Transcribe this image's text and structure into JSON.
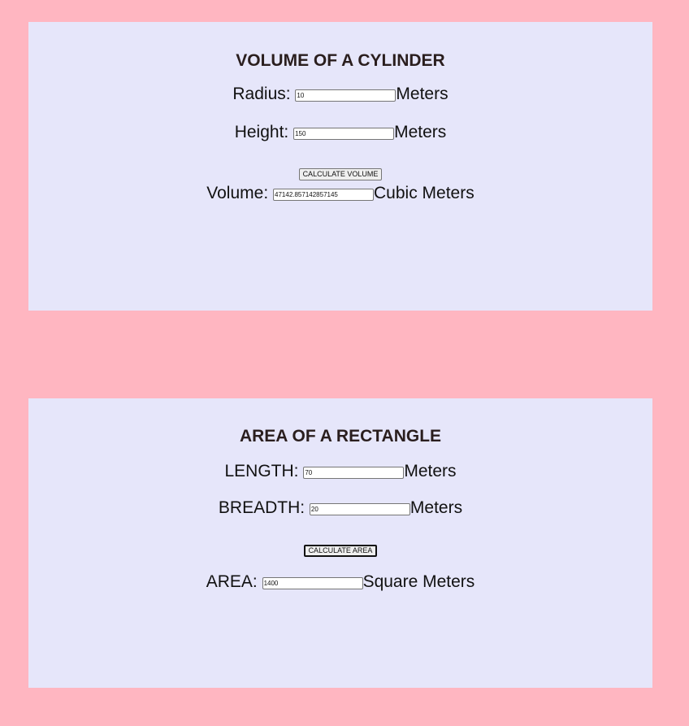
{
  "cylinder": {
    "title": "VOLUME OF A CYLINDER",
    "radius_label": "Radius:",
    "radius_value": "10",
    "radius_unit": "Meters",
    "height_label": "Height:",
    "height_value": "150",
    "height_unit": "Meters",
    "button_label": "CALCULATE VOLUME",
    "volume_label": "Volume:",
    "volume_value": "47142.857142857145",
    "volume_unit": "Cubic Meters"
  },
  "rectangle": {
    "title": "AREA OF A RECTANGLE",
    "length_label": "LENGTH:",
    "length_value": "70",
    "length_unit": "Meters",
    "breadth_label": "BREADTH:",
    "breadth_value": "20",
    "breadth_unit": "Meters",
    "button_label": "CALCULATE AREA",
    "area_label": "AREA:",
    "area_value": "1400",
    "area_unit": "Square Meters"
  }
}
